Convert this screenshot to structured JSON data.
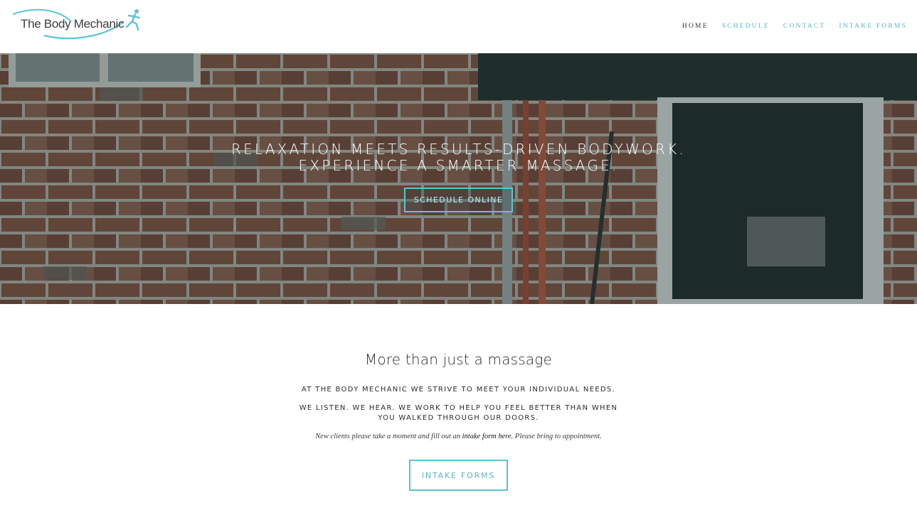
{
  "header": {
    "logo_text": "The Body Mechanic",
    "nav": [
      {
        "label": "HOME",
        "active": true
      },
      {
        "label": "SCHEDULE",
        "active": false
      },
      {
        "label": "CONTACT",
        "active": false
      },
      {
        "label": "INTAKE FORMS",
        "active": false
      }
    ]
  },
  "hero": {
    "headline_line1": "RELAXATION MEETS RESULTS-DRIVEN BODYWORK.",
    "headline_line2": "EXPERIENCE A SMARTER MASSAGE.",
    "button_label": "SCHEDULE ONLINE"
  },
  "content": {
    "title": "More than just a massage",
    "paragraph1": "AT THE BODY MECHANIC WE STRIVE TO MEET YOUR INDIVIDUAL NEEDS.",
    "paragraph2_line1": "WE LISTEN. WE HEAR. WE WORK TO HELP YOU FEEL BETTER THAN WHEN",
    "paragraph2_line2": "YOU WALKED THROUGH OUR DOORS.",
    "note_prefix": "New clients please take a moment and fill out an ",
    "note_link": "intake form here.",
    "note_suffix": " Please bring to appointment.",
    "button_label": "INTAKE FORMS"
  },
  "colors": {
    "accent": "#5bc4d3",
    "brick": "#7a4a3a",
    "overlay": "#1c3434"
  },
  "icons": {
    "logo_figure": "running-figure-icon",
    "logo_swoosh": "swoosh-icon"
  }
}
